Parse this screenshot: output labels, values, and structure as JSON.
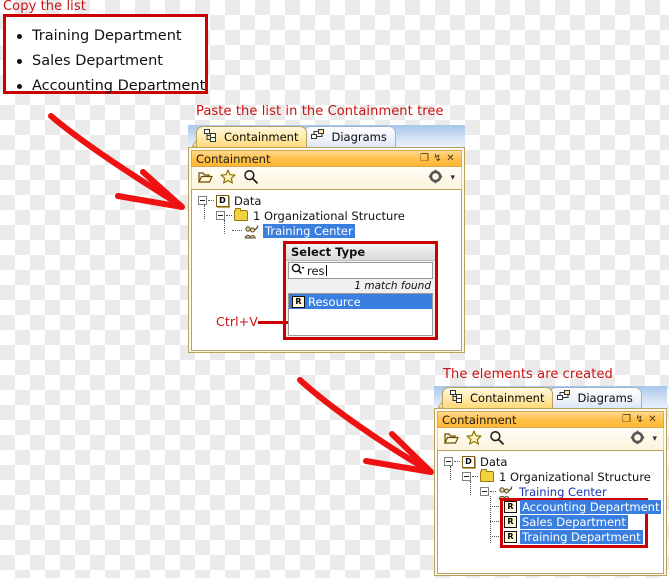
{
  "annotations": {
    "copy_the_list": "Copy the list",
    "paste_hint": "Paste the list in the Containment tree",
    "elements_created": "The elements are created",
    "ctrl_v": "Ctrl+V"
  },
  "copy_list": {
    "items": [
      "Training Department",
      "Sales Department",
      "Accounting Department"
    ]
  },
  "colors": {
    "annotation_red": "#cc1111",
    "box_border_red": "#cc0000",
    "selection_blue": "#3a7fe0",
    "titlebar_orange": "#ffc14d",
    "tab_active_yellow": "#ffd97a",
    "folder_yellow": "#f2d23f",
    "tree_link_blue": "#1a32b4"
  },
  "panel_one": {
    "tabs": [
      {
        "label": "Containment",
        "icon": "containment-tree-icon",
        "active": true
      },
      {
        "label": "Diagrams",
        "icon": "diagrams-icon",
        "active": false
      }
    ],
    "title": "Containment",
    "title_buttons": [
      {
        "name": "restore-icon",
        "glyph": "❐"
      },
      {
        "name": "pin-icon",
        "glyph": "↯"
      },
      {
        "name": "close-icon",
        "glyph": "✕"
      }
    ],
    "toolbar": [
      {
        "name": "open-folder-icon",
        "glyph": "📂"
      },
      {
        "name": "favorite-star-icon",
        "glyph": "☆"
      },
      {
        "name": "search-icon",
        "glyph": "🔍"
      },
      {
        "name": "gear-options-icon",
        "glyph": "⚙"
      },
      {
        "name": "dropdown-arrow-icon",
        "glyph": "▾"
      }
    ],
    "tree": [
      {
        "label": "Data",
        "icon": "model-data-icon",
        "depth": 0,
        "state": "normal"
      },
      {
        "label": "1 Organizational Structure",
        "icon": "folder-icon",
        "depth": 1,
        "state": "normal"
      },
      {
        "label": "Training Center",
        "icon": "actor-group-icon",
        "depth": 2,
        "state": "selected"
      }
    ]
  },
  "select_type_dialog": {
    "title": "Select Type",
    "search_value": "res",
    "search_icon": "search-dropdown-icon",
    "match_text": "1 match found",
    "results": [
      {
        "label": "Resource",
        "icon": "R",
        "selected": true
      }
    ]
  },
  "panel_two": {
    "tabs": [
      {
        "label": "Containment",
        "icon": "containment-tree-icon",
        "active": true
      },
      {
        "label": "Diagrams",
        "icon": "diagrams-icon",
        "active": false
      }
    ],
    "title": "Containment",
    "title_buttons": [
      {
        "name": "restore-icon",
        "glyph": "❐"
      },
      {
        "name": "pin-icon",
        "glyph": "↯"
      },
      {
        "name": "close-icon",
        "glyph": "✕"
      }
    ],
    "toolbar": [
      {
        "name": "open-folder-icon",
        "glyph": "📂"
      },
      {
        "name": "favorite-star-icon",
        "glyph": "☆"
      },
      {
        "name": "search-icon",
        "glyph": "🔍"
      },
      {
        "name": "gear-options-icon",
        "glyph": "⚙"
      },
      {
        "name": "dropdown-arrow-icon",
        "glyph": "▾"
      }
    ],
    "tree": [
      {
        "label": "Data",
        "icon": "model-data-icon",
        "depth": 0,
        "state": "normal"
      },
      {
        "label": "1 Organizational Structure",
        "icon": "folder-icon",
        "depth": 1,
        "state": "normal"
      },
      {
        "label": "Training Center",
        "icon": "actor-group-icon",
        "depth": 2,
        "state": "link"
      },
      {
        "label": "Accounting Department",
        "icon": "R",
        "depth": 3,
        "state": "selected"
      },
      {
        "label": "Sales Department",
        "icon": "R",
        "depth": 3,
        "state": "selected"
      },
      {
        "label": "Training Department",
        "icon": "R",
        "depth": 3,
        "state": "selected"
      }
    ]
  }
}
